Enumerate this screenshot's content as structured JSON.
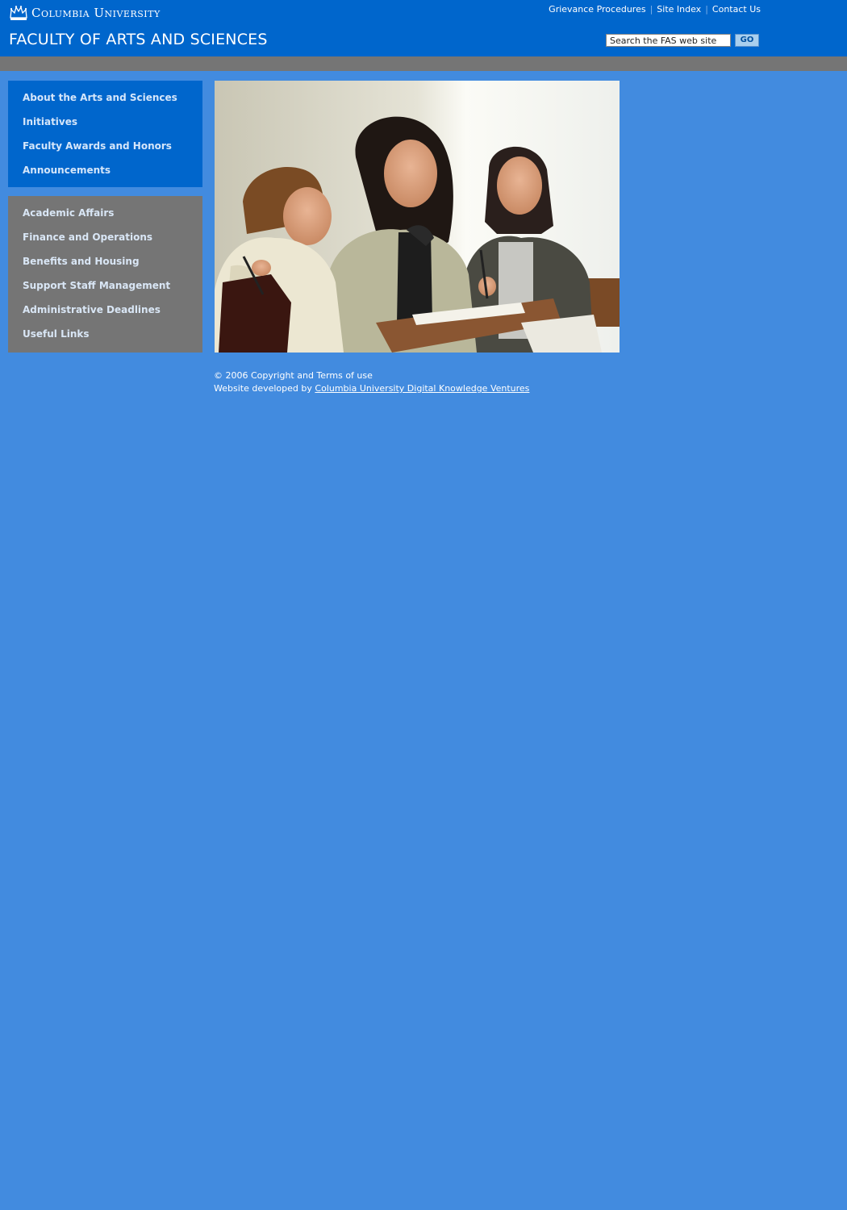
{
  "header": {
    "university_name": "Columbia University",
    "section_title": "FACULTY OF ARTS AND SCIENCES",
    "utility_links": [
      "Grievance Procedures",
      "Site Index",
      "Contact Us"
    ],
    "search": {
      "value": "Search the FAS web site",
      "button_label": "GO"
    },
    "logo_icon": "crown-icon"
  },
  "sidebar": {
    "primary_items": [
      {
        "label": "About the Arts and Sciences"
      },
      {
        "label": "Initiatives"
      },
      {
        "label": "Faculty Awards and Honors"
      },
      {
        "label": "Announcements"
      }
    ],
    "secondary_items": [
      {
        "label": "Academic Affairs"
      },
      {
        "label": "Finance and Operations"
      },
      {
        "label": "Benefits and Housing"
      },
      {
        "label": "Support Staff Management"
      },
      {
        "label": "Administrative Deadlines"
      },
      {
        "label": "Useful Links"
      }
    ]
  },
  "footer": {
    "copyright": "© 2006 Copyright and Terms of use",
    "developed_by_prefix": "Website developed by",
    "developer_link": "Columbia University Digital Knowledge Ventures"
  },
  "colors": {
    "page_background": "#428bdf",
    "header_blue": "#0066cc",
    "gray_band": "#757575",
    "nav_text": "#d5e6fa"
  }
}
